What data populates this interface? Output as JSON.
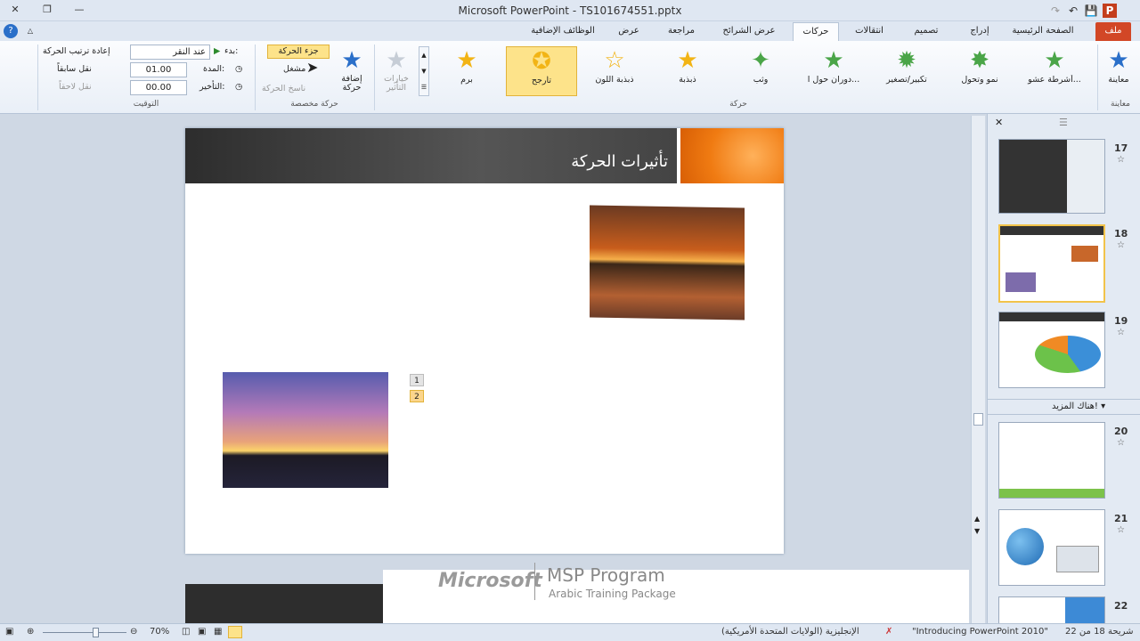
{
  "window": {
    "title": "Microsoft PowerPoint - TS101674551.pptx",
    "qat_icons": [
      "save-icon",
      "undo-icon",
      "redo-icon"
    ],
    "app_icon_letter": "P"
  },
  "tabs": [
    {
      "id": "file",
      "label": "ملف"
    },
    {
      "id": "home",
      "label": "الصفحة الرئيسية"
    },
    {
      "id": "insert",
      "label": "إدراج"
    },
    {
      "id": "design",
      "label": "تصميم"
    },
    {
      "id": "transitions",
      "label": "انتقالات"
    },
    {
      "id": "animations",
      "label": "حركات"
    },
    {
      "id": "slideshow",
      "label": "عرض الشرائح"
    },
    {
      "id": "review",
      "label": "مراجعة"
    },
    {
      "id": "view",
      "label": "عرض"
    },
    {
      "id": "addins",
      "label": "الوظائف الإضافية"
    }
  ],
  "ribbon": {
    "preview_label": "معاينة",
    "preview_group": "معاينة",
    "effects": [
      {
        "label": "أشرطة عشو...",
        "color": "#4aa548"
      },
      {
        "label": "نمو وتحول",
        "color": "#4aa548"
      },
      {
        "label": "تكبير/تصغير",
        "color": "#4aa548"
      },
      {
        "label": "دوران حول ا...",
        "color": "#4aa548"
      },
      {
        "label": "وثب",
        "color": "#4aa548"
      },
      {
        "label": "ذبذبة",
        "color": "#f2b415"
      },
      {
        "label": "ذبذبة اللون",
        "color": "#f2b415"
      },
      {
        "label": "تأرجح",
        "color": "#f2b415",
        "selected": true
      },
      {
        "label": "برم",
        "color": "#f2b415"
      }
    ],
    "effect_options_label": "خيارات التأثير",
    "animation_group": "حركة",
    "add_animation_label": "إضافة حركة",
    "animation_pane_label": "جزء الحركة",
    "trigger_label": "مشغل",
    "painter_label": "ناسخ الحركة",
    "advanced_group": "حركة مخصصة",
    "start_label": "بدء:",
    "start_value": "عند النقر",
    "duration_label": "المدة:",
    "duration_value": "01.00",
    "delay_label": "التأخير:",
    "delay_value": "00.00",
    "reorder_label": "إعادة ترتيب الحركة",
    "move_earlier": "نقل سابقاً",
    "move_later": "نقل لاحقاً",
    "timing_group": "التوقيت"
  },
  "slide": {
    "title": "تأثيرات الحركة",
    "tags": [
      "1",
      "2"
    ]
  },
  "pane": {
    "thumbs": [
      {
        "num": "17"
      },
      {
        "num": "18",
        "selected": true
      },
      {
        "num": "19"
      },
      {
        "num": "20"
      },
      {
        "num": "21"
      },
      {
        "num": "22"
      }
    ],
    "section_label": "هناك المزيد!"
  },
  "watermark": {
    "brand": "Microsoft",
    "line1": "MSP Program",
    "line2": "Arabic Training Package"
  },
  "status": {
    "slide_info": "شريحة 18 من 22",
    "theme": "\"Introducing PowerPoint 2010\"",
    "language": "الإنجليزية (الولايات المتحدة الأمريكية)",
    "zoom": "70%"
  }
}
